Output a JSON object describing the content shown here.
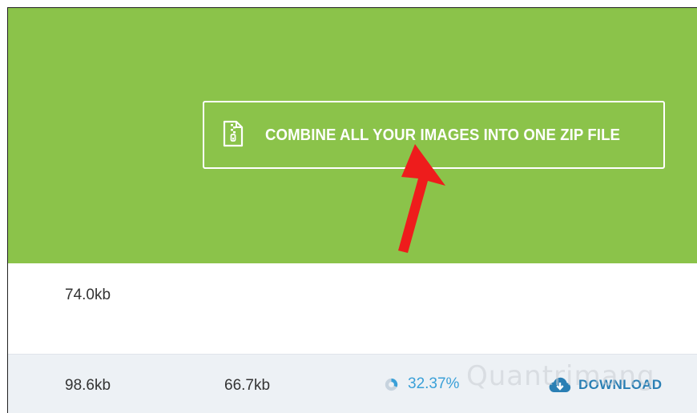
{
  "banner": {
    "zip_button_label": "COMBINE ALL YOUR IMAGES INTO ONE ZIP FILE",
    "icon": "zip-file-icon",
    "color": "#8bc34a"
  },
  "rows": [
    {
      "original_size": "74.0kb"
    },
    {
      "original_size": "98.6kb",
      "new_size": "66.7kb",
      "savings": "32.37%",
      "download_label": "DOWNLOAD"
    }
  ],
  "colors": {
    "savings": "#3aa0d8",
    "download": "#2a7fb4",
    "annotation_arrow": "#ee1c1c"
  },
  "watermark_text": "Quantrimang"
}
